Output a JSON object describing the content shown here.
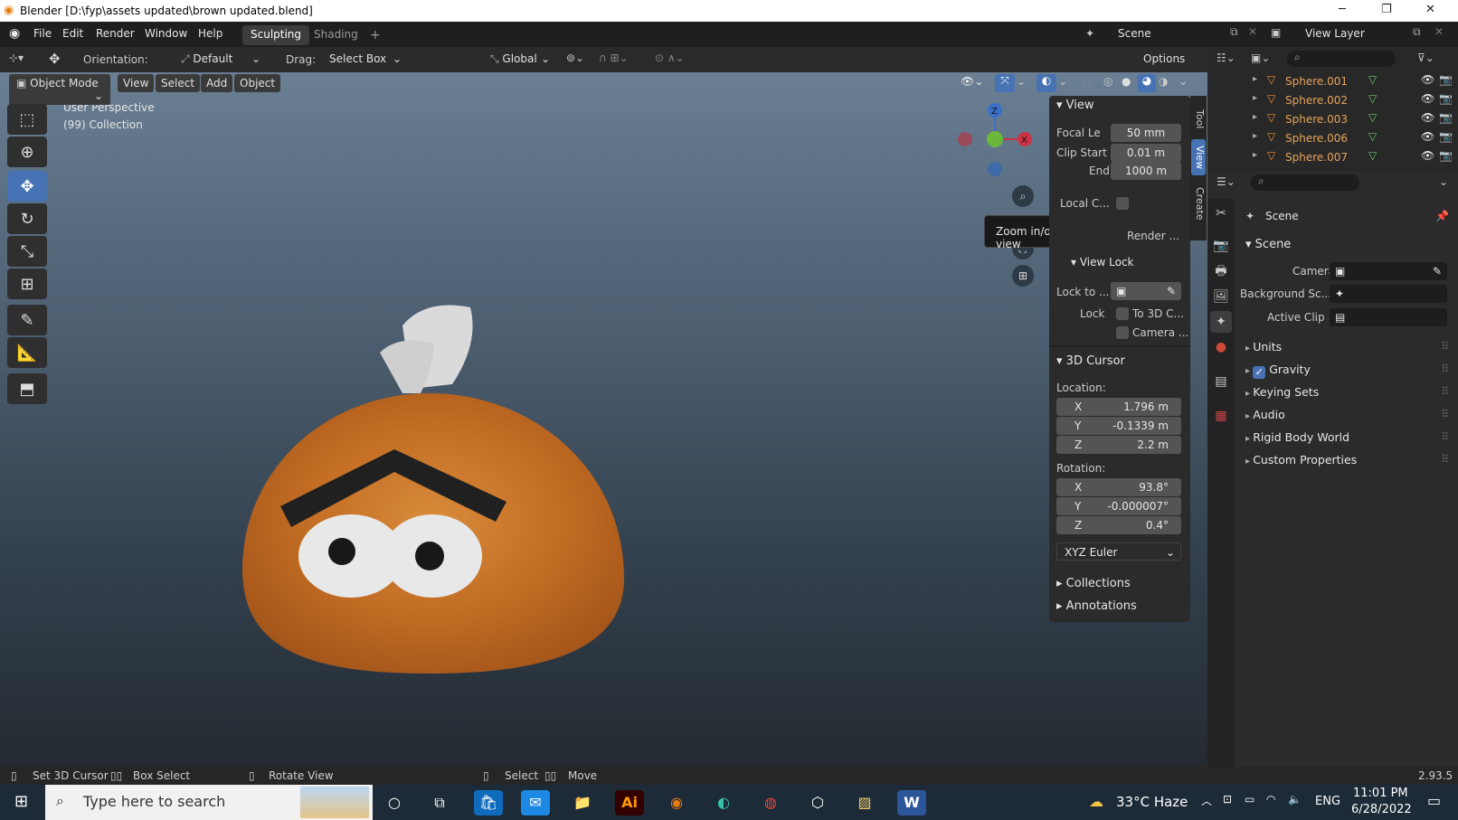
{
  "window": {
    "title": "Blender [D:\\fyp\\assets updated\\brown updated.blend]",
    "minimize": "─",
    "restore": "❐",
    "close": "✕"
  },
  "menu": [
    "File",
    "Edit",
    "Render",
    "Window",
    "Help"
  ],
  "workspaces": {
    "active": "Sculpting",
    "inactive": "Shading",
    "add": "+"
  },
  "scene_selector": {
    "label": "Scene",
    "view_layer": "View Layer"
  },
  "tool_header": {
    "orientation_label": "Orientation:",
    "orientation_value": "Default",
    "drag_label": "Drag:",
    "drag_value": "Select Box",
    "transform_orientation": "Global",
    "options": "Options"
  },
  "viewport_header": {
    "mode": "Object Mode",
    "view": "View",
    "select": "Select",
    "add": "Add",
    "object": "Object"
  },
  "viewport": {
    "perspective": "User Perspective",
    "collection": "(99) Collection"
  },
  "gizmo": {
    "z": "Z",
    "x": "X"
  },
  "tooltip": "Zoom in/out in the view",
  "npanel": {
    "tabs": [
      "Tool",
      "View",
      "Create"
    ],
    "view_header": "View",
    "focal_label": "Focal Le",
    "focal_value": "50 mm",
    "clip_start_label": "Clip Start",
    "clip_start_value": "0.01 m",
    "end_label": "End",
    "end_value": "1000 m",
    "local_label": "Local C...",
    "render_label": "Render ...",
    "view_lock_header": "View Lock",
    "lock_to_label": "Lock to ...",
    "lock_label": "Lock",
    "to3d_label": "To 3D C...",
    "camera_label": "Camera ...",
    "cursor_header": "3D Cursor",
    "location_label": "Location:",
    "loc_x": "1.796 m",
    "loc_y": "-0.1339 m",
    "loc_z": "2.2 m",
    "rotation_label": "Rotation:",
    "rot_x": "93.8°",
    "rot_y": "-0.000007°",
    "rot_z": "0.4°",
    "euler": "XYZ Euler",
    "collections": "Collections",
    "annotations": "Annotations",
    "axis_x": "X",
    "axis_y": "Y",
    "axis_z": "Z"
  },
  "outliner": {
    "items": [
      "Sphere.001",
      "Sphere.002",
      "Sphere.003",
      "Sphere.006",
      "Sphere.007"
    ]
  },
  "properties": {
    "header": "Scene",
    "scene_section": "Scene",
    "camera_label": "Camera",
    "background_label": "Background Sc...",
    "active_clip_label": "Active Clip",
    "sections": [
      "Units",
      "Gravity",
      "Keying Sets",
      "Audio",
      "Rigid Body World",
      "Custom Properties"
    ]
  },
  "statusbar": {
    "set_cursor": "Set 3D Cursor",
    "box_select": "Box Select",
    "rotate": "Rotate View",
    "select": "Select",
    "move": "Move",
    "version": "2.93.5"
  },
  "taskbar": {
    "search": "Type here to search",
    "weather": "33°C  Haze",
    "lang": "ENG",
    "time": "11:01 PM",
    "date": "6/28/2022"
  }
}
